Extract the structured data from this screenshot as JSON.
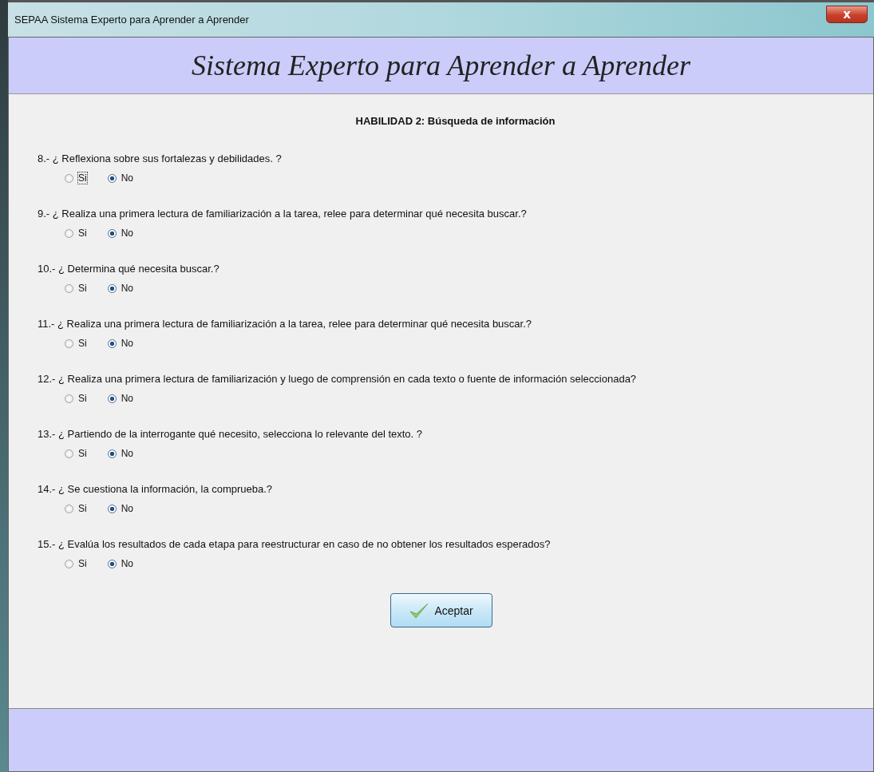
{
  "window": {
    "title": "SEPAA Sistema Experto para Aprender a Aprender",
    "close": "x"
  },
  "header": {
    "title": "Sistema Experto para Aprender a Aprender"
  },
  "section": {
    "title": "HABILIDAD 2: Búsqueda de información"
  },
  "questions": [
    {
      "text": "8.- ¿ Reflexiona sobre sus fortalezas y debilidades. ?",
      "options": [
        {
          "label": "Si",
          "selected": false,
          "focused": true
        },
        {
          "label": "No",
          "selected": true,
          "focused": false
        }
      ]
    },
    {
      "text": "9.- ¿ Realiza una primera lectura de familiarización a la tarea, relee para determinar qué necesita buscar.?",
      "options": [
        {
          "label": "Si",
          "selected": false,
          "focused": false
        },
        {
          "label": "No",
          "selected": true,
          "focused": false
        }
      ]
    },
    {
      "text": "10.- ¿ Determina qué necesita buscar.?",
      "options": [
        {
          "label": "Si",
          "selected": false,
          "focused": false
        },
        {
          "label": "No",
          "selected": true,
          "focused": false
        }
      ]
    },
    {
      "text": "11.- ¿ Realiza una primera lectura de familiarización a la tarea, relee para determinar qué necesita buscar.?",
      "options": [
        {
          "label": "Si",
          "selected": false,
          "focused": false
        },
        {
          "label": "No",
          "selected": true,
          "focused": false
        }
      ]
    },
    {
      "text": "12.- ¿ Realiza una primera lectura de familiarización y luego de comprensión en cada texto o fuente de información seleccionada?",
      "options": [
        {
          "label": "Si",
          "selected": false,
          "focused": false
        },
        {
          "label": "No",
          "selected": true,
          "focused": false
        }
      ]
    },
    {
      "text": "13.- ¿ Partiendo de la interrogante qué necesito, selecciona lo relevante del texto. ?",
      "options": [
        {
          "label": "Si",
          "selected": false,
          "focused": false
        },
        {
          "label": "No",
          "selected": true,
          "focused": false
        }
      ]
    },
    {
      "text": "14.- ¿ Se cuestiona la información, la comprueba.?",
      "options": [
        {
          "label": "Si",
          "selected": false,
          "focused": false
        },
        {
          "label": "No",
          "selected": true,
          "focused": false
        }
      ]
    },
    {
      "text": "15.- ¿ Evalúa los resultados de cada etapa para reestructurar en caso de no obtener los resultados esperados?",
      "options": [
        {
          "label": "Si",
          "selected": false,
          "focused": false
        },
        {
          "label": "No",
          "selected": true,
          "focused": false
        }
      ]
    }
  ],
  "button": {
    "label": "Aceptar"
  }
}
